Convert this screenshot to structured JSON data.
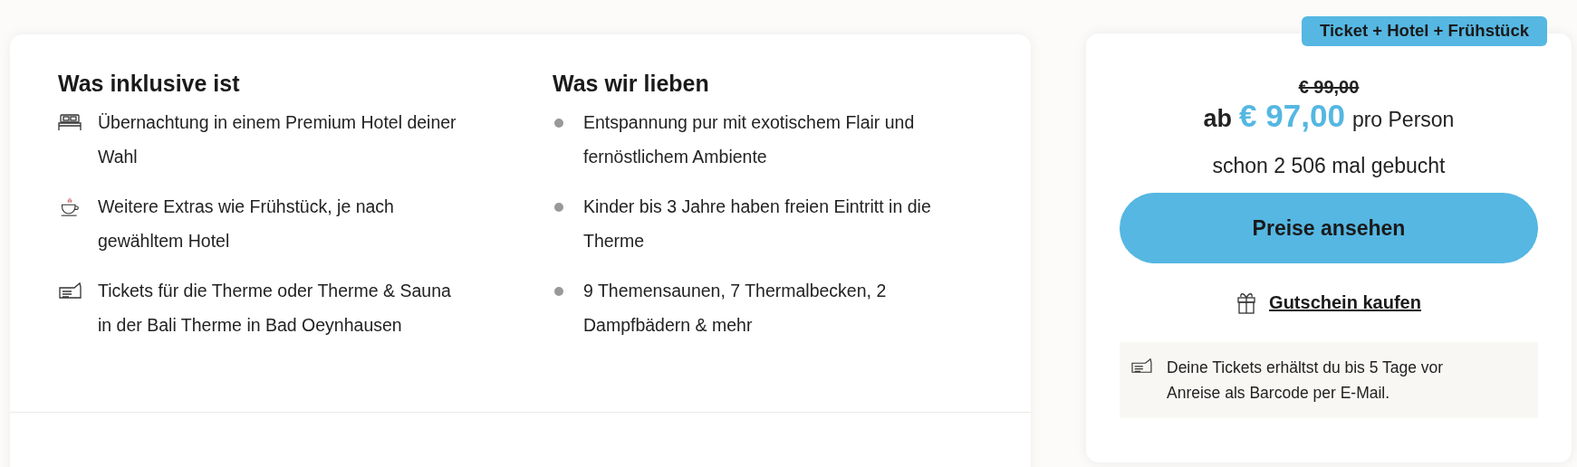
{
  "included": {
    "title": "Was inklusive ist",
    "items": [
      {
        "kind": "bed",
        "text": "Übernachtung in einem Premium Hotel deiner Wahl"
      },
      {
        "kind": "cup",
        "text": "Weitere Extras wie Frühstück, je nach gewähltem Hotel"
      },
      {
        "kind": "ticket",
        "text": "Tickets für die Therme oder Therme & Sauna in der Bali Therme in Bad Oeynhausen"
      }
    ]
  },
  "loved": {
    "title": "Was wir lieben",
    "items": [
      "Entspannung pur mit exotischem Flair und fernöstlichem Ambiente",
      "Kinder bis 3 Jahre haben freien Eintritt in die Therme",
      "9 Themensaunen, 7 Thermalbecken, 2 Dampfbädern & mehr"
    ]
  },
  "offer": {
    "badge": "Ticket + Hotel + Frühstück",
    "old_price": "€ 99,00",
    "prefix": "ab",
    "price": "€ 97,00",
    "unit": "pro Person",
    "bookings": "schon 2 506 mal gebucht",
    "cta": "Preise ansehen",
    "voucher_link": "Gutschein kaufen",
    "info": "Deine Tickets erhältst du bis 5 Tage vor Anreise als Barcode per E-Mail."
  }
}
